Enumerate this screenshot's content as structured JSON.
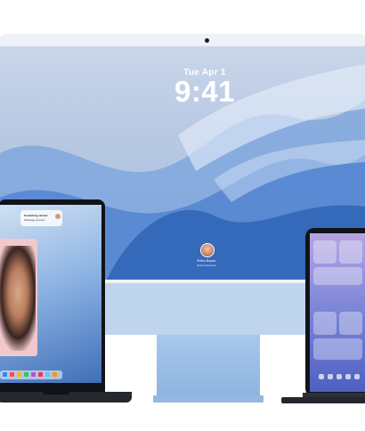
{
  "imac": {
    "date": "Tue Apr 1",
    "time": "9:41",
    "user_name": "Erika Bauer",
    "login_hint": "Enter Password"
  },
  "macbook": {
    "notification": {
      "title": "Something started",
      "body": "Message preview"
    },
    "dock_colors": [
      "#1f8bff",
      "#ff4b3e",
      "#ffb300",
      "#34c759",
      "#af52de",
      "#ff2d55",
      "#5ac8fa",
      "#ff9500"
    ]
  },
  "icons": {
    "camera": "camera-icon",
    "avatar": "user-avatar",
    "notification_avatar": "notification-avatar"
  },
  "colors": {
    "imac_blue": "#a8c8ec",
    "macbook_black": "#121318",
    "ipad_purple": "#7f88d8"
  }
}
